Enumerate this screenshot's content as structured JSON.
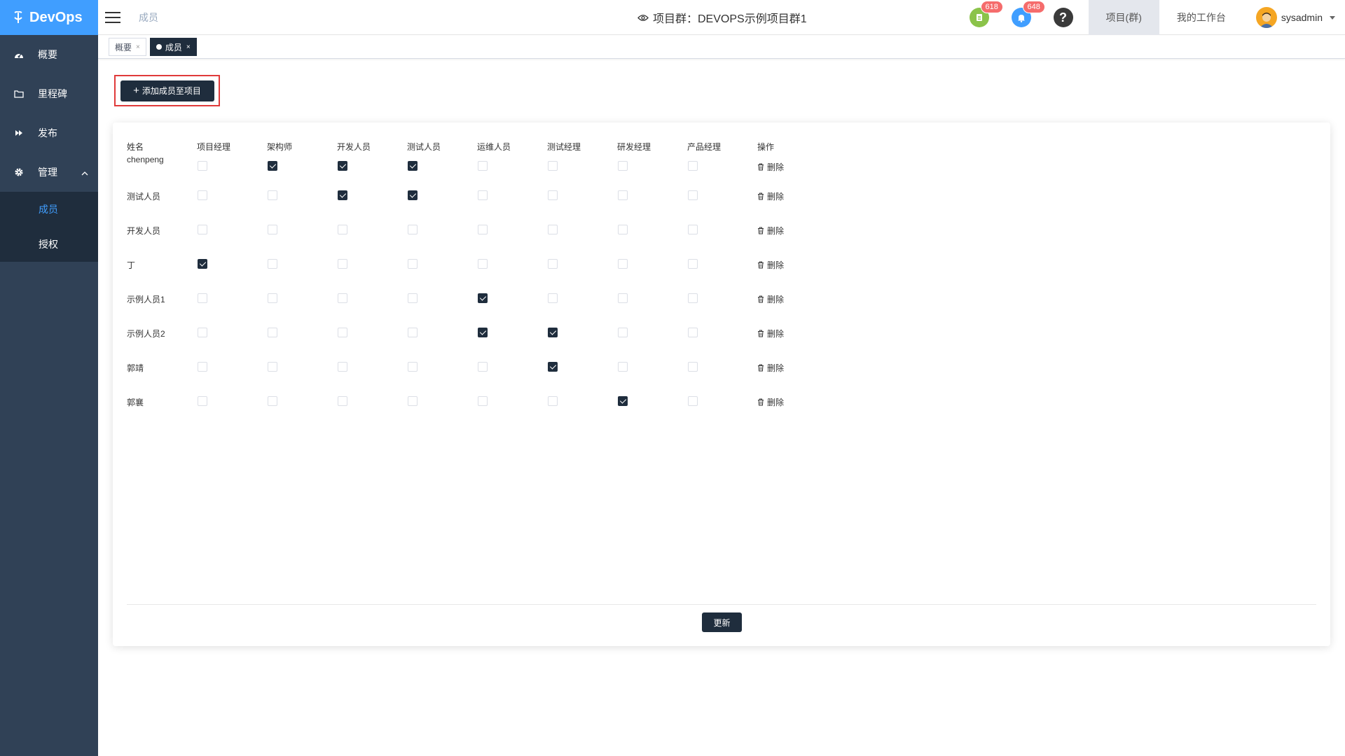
{
  "app": {
    "name": "DevOps"
  },
  "sidebar": {
    "items": [
      {
        "label": "概要",
        "icon": "dashboard-icon"
      },
      {
        "label": "里程碑",
        "icon": "folder-icon"
      },
      {
        "label": "发布",
        "icon": "fast-forward-icon"
      },
      {
        "label": "管理",
        "icon": "gear-icon"
      }
    ],
    "submenu": [
      {
        "label": "成员",
        "active": true
      },
      {
        "label": "授权",
        "active": false
      }
    ]
  },
  "topbar": {
    "breadcrumb": "成员",
    "title": "项目群：DEVOPS示例项目群1",
    "task_badge": "618",
    "notify_badge": "648",
    "help": "?",
    "tab_project": "项目(群)",
    "tab_workbench": "我的工作台",
    "username": "sysadmin"
  },
  "tags": [
    {
      "label": "概要",
      "close": "×"
    },
    {
      "label": "成员",
      "close": "×"
    }
  ],
  "actions": {
    "add_member": "添加成员至项目",
    "update": "更新",
    "delete": "删除"
  },
  "table": {
    "headers": [
      "姓名",
      "项目经理",
      "架构师",
      "开发人员",
      "测试人员",
      "运维人员",
      "测试经理",
      "研发经理",
      "产品经理",
      "操作"
    ],
    "rows": [
      {
        "name": "chenpeng",
        "roles": [
          false,
          true,
          true,
          true,
          false,
          false,
          false,
          false
        ]
      },
      {
        "name": "测试人员",
        "roles": [
          false,
          false,
          true,
          true,
          false,
          false,
          false,
          false
        ]
      },
      {
        "name": "开发人员",
        "roles": [
          false,
          false,
          false,
          false,
          false,
          false,
          false,
          false
        ]
      },
      {
        "name": "丁",
        "roles": [
          true,
          false,
          false,
          false,
          false,
          false,
          false,
          false
        ]
      },
      {
        "name": "示例人员1",
        "roles": [
          false,
          false,
          false,
          false,
          true,
          false,
          false,
          false
        ]
      },
      {
        "name": "示例人员2",
        "roles": [
          false,
          false,
          false,
          false,
          true,
          true,
          false,
          false
        ]
      },
      {
        "name": "郭靖",
        "roles": [
          false,
          false,
          false,
          false,
          false,
          true,
          false,
          false
        ]
      },
      {
        "name": "郭襄",
        "roles": [
          false,
          false,
          false,
          false,
          false,
          false,
          true,
          false
        ]
      }
    ]
  },
  "colors": {
    "sidebar_bg": "#304156",
    "logo_bg": "#409eff",
    "dark_button": "#1f2d3d",
    "badge_red": "#f56c6c",
    "task_icon_green": "#8bc34a",
    "notify_icon_blue": "#409eff",
    "highlight_border": "#e03a3a"
  }
}
